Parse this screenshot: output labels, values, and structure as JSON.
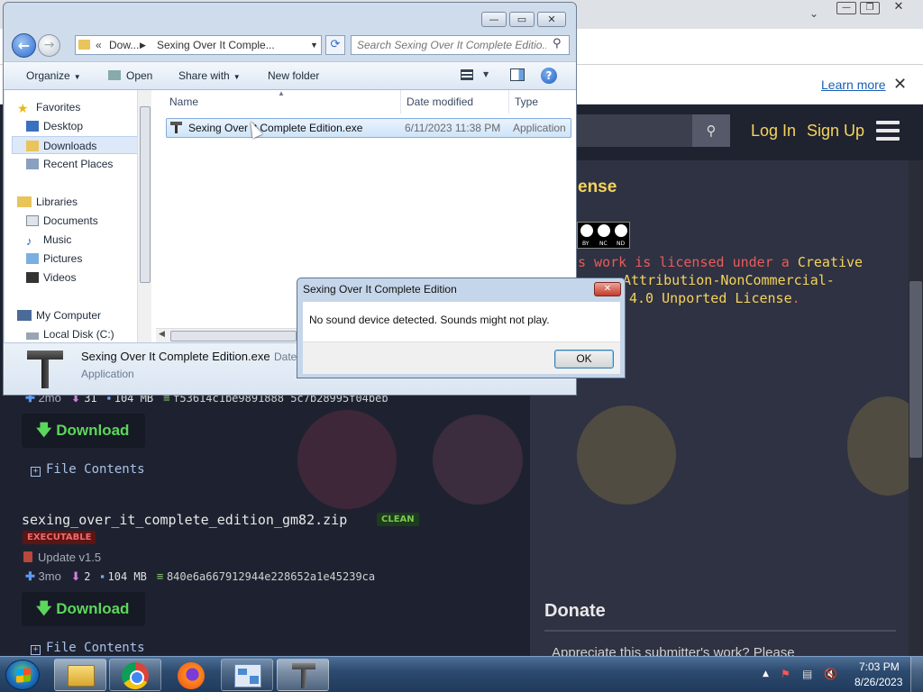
{
  "browser": {
    "infobar_link": "Learn more",
    "header_login": "Log In",
    "header_signup": "Sign Up",
    "license_title": "ense",
    "cc_badge": [
      "BY",
      "NC",
      "ND"
    ],
    "license_line1_red": "s work is licensed under a ",
    "license_line1_yellow": "Creative",
    "license_line2_yellow": "Attribution-NonCommercial-",
    "license_line3_yellow": "4.0 Unported License",
    "license_line3_end": ".",
    "file1": {
      "age": "2mo",
      "downloads": "31",
      "size": "104 MB",
      "hash": "f53614c1be9891888 5c7b28995f04beb",
      "download_label": "Download",
      "contents_label": "File Contents"
    },
    "file2": {
      "name": "sexing_over_it_complete_edition_gm82.zip",
      "badge_clean": "CLEAN",
      "badge_exec": "EXECUTABLE",
      "update_note": "Update v1.5",
      "age": "3mo",
      "downloads": "2",
      "size": "104 MB",
      "hash": "840e6a667912944e228652a1e45239ca",
      "download_label": "Download",
      "contents_label": "File Contents"
    },
    "donate_title": "Donate",
    "donate_text": "Appreciate this submitter's work? Please"
  },
  "explorer": {
    "breadcrumb_prefix": "«",
    "breadcrumb_1": "Dow...",
    "breadcrumb_2": "Sexing Over It Comple...",
    "search_placeholder": "Search Sexing Over It Complete Editio...",
    "toolbar": {
      "organize": "Organize",
      "open": "Open",
      "share_with": "Share with",
      "new_folder": "New folder"
    },
    "nav": {
      "favorites": "Favorites",
      "desktop": "Desktop",
      "downloads": "Downloads",
      "recent_places": "Recent Places",
      "libraries": "Libraries",
      "documents": "Documents",
      "music": "Music",
      "pictures": "Pictures",
      "videos": "Videos",
      "my_computer": "My Computer",
      "local_disk": "Local Disk (C:)"
    },
    "columns": {
      "name": "Name",
      "date_modified": "Date modified",
      "type": "Type"
    },
    "files": [
      {
        "name": "Sexing Over It Complete Edition.exe",
        "date": "6/11/2023 11:38 PM",
        "type": "Application"
      }
    ],
    "details": {
      "name": "Sexing Over It Complete Edition.exe",
      "date_label": "Date",
      "type": "Application"
    }
  },
  "dialog": {
    "title": "Sexing Over It Complete Edition",
    "message": "No sound device detected. Sounds might not play.",
    "ok": "OK"
  },
  "taskbar": {
    "time": "7:03 PM",
    "date": "8/26/2023"
  },
  "colors": {
    "accent_yellow": "#f6d35b",
    "license_red": "#e95c5c",
    "download_green": "#5cd65c"
  }
}
